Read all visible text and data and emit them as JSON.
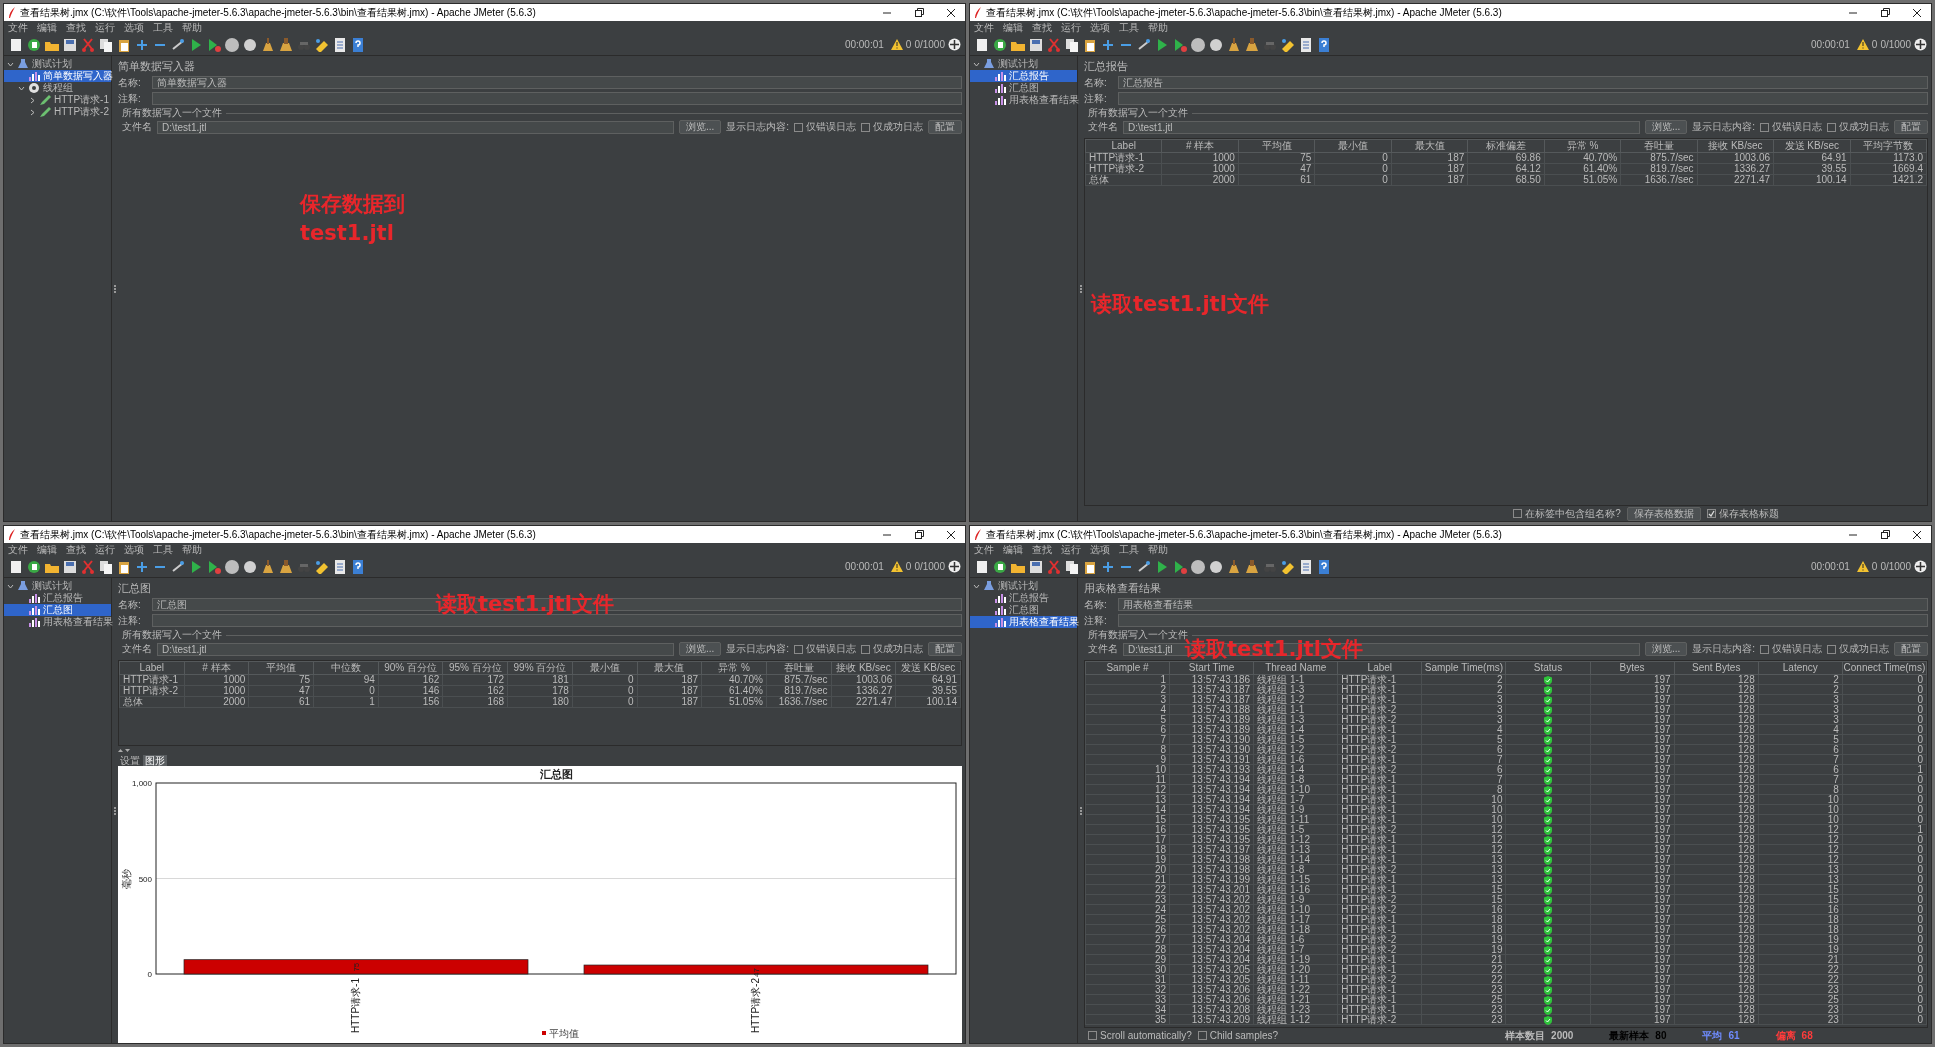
{
  "windows": [
    {
      "kind": "writer",
      "title": "查看结果树.jmx (C:\\软件\\Tools\\apache-jmeter-5.6.3\\apache-jmeter-5.6.3\\bin\\查看结果树.jmx) - Apache JMeter (5.6.3)",
      "menu": [
        "文件",
        "编辑",
        "查找",
        "运行",
        "选项",
        "工具",
        "帮助"
      ],
      "status": {
        "time": "00:00:01",
        "warnings": "0",
        "threads": "0/1000"
      },
      "tree": [
        {
          "label": "测试计划",
          "kind": "plan",
          "expanded": true,
          "selected": false,
          "children": [
            {
              "label": "简单数据写入器",
              "kind": "listener",
              "selected": true
            },
            {
              "label": "线程组",
              "kind": "group",
              "expanded": true,
              "selected": false,
              "children": [
                {
                  "label": "HTTP请求-1",
                  "kind": "sampler",
                  "expanded": false,
                  "selected": false
                },
                {
                  "label": "HTTP请求-2",
                  "kind": "sampler",
                  "expanded": false,
                  "selected": false
                }
              ]
            }
          ]
        }
      ],
      "panel": {
        "heading": "简单数据写入器",
        "name_label": "名称:",
        "name": "简单数据写入器",
        "comment_label": "注释:",
        "file_section": "所有数据写入一个文件",
        "file_label": "文件名",
        "file": "D:\\test1.jtl",
        "browse": "浏览...",
        "log_label": "显示日志内容:",
        "checks": [
          {
            "label": "仅错误日志",
            "checked": false
          },
          {
            "label": "仅成功日志",
            "checked": false
          }
        ],
        "config": "配置"
      },
      "annotation": [
        "保存数据到",
        "test1.jtl"
      ]
    },
    {
      "kind": "summary",
      "title": "查看结果树.jmx (C:\\软件\\Tools\\apache-jmeter-5.6.3\\apache-jmeter-5.6.3\\bin\\查看结果树.jmx) - Apache JMeter (5.6.3)",
      "menu": [
        "文件",
        "编辑",
        "查找",
        "运行",
        "选项",
        "工具",
        "帮助"
      ],
      "status": {
        "time": "00:00:01",
        "warnings": "0",
        "threads": "0/1000"
      },
      "tree": [
        {
          "label": "测试计划",
          "kind": "plan",
          "expanded": true,
          "selected": false,
          "children": [
            {
              "label": "汇总报告",
              "kind": "listener",
              "selected": true
            },
            {
              "label": "汇总图",
              "kind": "listener",
              "selected": false
            },
            {
              "label": "用表格查看结果",
              "kind": "listener",
              "selected": false
            }
          ]
        }
      ],
      "panel": {
        "heading": "汇总报告",
        "name_label": "名称:",
        "name": "汇总报告",
        "comment_label": "注释:",
        "file_section": "所有数据写入一个文件",
        "file_label": "文件名",
        "file": "D:\\test1.jtl",
        "browse": "浏览...",
        "log_label": "显示日志内容:",
        "checks": [
          {
            "label": "仅错误日志",
            "checked": false
          },
          {
            "label": "仅成功日志",
            "checked": false
          }
        ],
        "config": "配置"
      },
      "table": {
        "columns": [
          "Label",
          "# 样本",
          "平均值",
          "最小值",
          "最大值",
          "标准偏差",
          "异常 %",
          "吞吐量",
          "接收 KB/sec",
          "发送 KB/sec",
          "平均字节数"
        ],
        "rows": [
          [
            "HTTP请求-1",
            "1000",
            "75",
            "0",
            "187",
            "69.86",
            "40.70%",
            "875.7/sec",
            "1003.06",
            "64.91",
            "1173.0"
          ],
          [
            "HTTP请求-2",
            "1000",
            "47",
            "0",
            "187",
            "64.12",
            "61.40%",
            "819.7/sec",
            "1336.27",
            "39.55",
            "1669.4"
          ],
          [
            "总体",
            "2000",
            "61",
            "0",
            "187",
            "68.50",
            "51.05%",
            "1636.7/sec",
            "2271.47",
            "100.14",
            "1421.2"
          ]
        ]
      },
      "footer": [
        {
          "kind": "check",
          "label": "在标签中包含组名称?",
          "checked": false
        },
        {
          "kind": "button",
          "label": "保存表格数据"
        },
        {
          "kind": "check",
          "label": "保存表格标题",
          "checked": true
        }
      ],
      "annotation": [
        "读取test1.jtl文件"
      ]
    },
    {
      "kind": "graph",
      "title": "查看结果树.jmx (C:\\软件\\Tools\\apache-jmeter-5.6.3\\apache-jmeter-5.6.3\\bin\\查看结果树.jmx) - Apache JMeter (5.6.3)",
      "menu": [
        "文件",
        "编辑",
        "查找",
        "运行",
        "选项",
        "工具",
        "帮助"
      ],
      "status": {
        "time": "00:00:01",
        "warnings": "0",
        "threads": "0/1000"
      },
      "tree": [
        {
          "label": "测试计划",
          "kind": "plan",
          "expanded": true,
          "selected": false,
          "children": [
            {
              "label": "汇总报告",
              "kind": "listener",
              "selected": false
            },
            {
              "label": "汇总图",
              "kind": "listener",
              "selected": true
            },
            {
              "label": "用表格查看结果",
              "kind": "listener",
              "selected": false
            }
          ]
        }
      ],
      "panel": {
        "heading": "汇总图",
        "name_label": "名称:",
        "name": "汇总图",
        "comment_label": "注释:",
        "file_section": "所有数据写入一个文件",
        "file_label": "文件名",
        "file": "D:\\test1.jtl",
        "browse": "浏览...",
        "log_label": "显示日志内容:",
        "checks": [
          {
            "label": "仅错误日志",
            "checked": false
          },
          {
            "label": "仅成功日志",
            "checked": false
          }
        ],
        "config": "配置"
      },
      "table": {
        "columns": [
          "Label",
          "# 样本",
          "平均值",
          "中位数",
          "90% 百分位",
          "95% 百分位",
          "99% 百分位",
          "最小值",
          "最大值",
          "异常 %",
          "吞吐量",
          "接收 KB/sec",
          "发送 KB/sec"
        ],
        "rows": [
          [
            "HTTP请求-1",
            "1000",
            "75",
            "94",
            "162",
            "172",
            "181",
            "0",
            "187",
            "40.70%",
            "875.7/sec",
            "1003.06",
            "64.91"
          ],
          [
            "HTTP请求-2",
            "1000",
            "47",
            "0",
            "146",
            "162",
            "178",
            "0",
            "187",
            "61.40%",
            "819.7/sec",
            "1336.27",
            "39.55"
          ],
          [
            "总体",
            "2000",
            "61",
            "1",
            "156",
            "168",
            "180",
            "0",
            "187",
            "51.05%",
            "1636.7/sec",
            "2271.47",
            "100.14"
          ]
        ]
      },
      "tabs": [
        {
          "label": "设置",
          "selected": false
        },
        {
          "label": "图形",
          "selected": true
        }
      ],
      "chart_data": {
        "type": "bar",
        "title": "汇总图",
        "ylabel": "毫秒",
        "categories": [
          "HTTP请求-1",
          "HTTP请求-2"
        ],
        "series": [
          {
            "name": "平均值",
            "color": "#cc0000",
            "values": [
              75,
              47
            ]
          }
        ],
        "ylim": [
          0,
          1000
        ],
        "yticks": [
          0,
          500,
          {
            "value": 1000,
            "label": "1,000"
          }
        ],
        "data_labels": true
      },
      "annotation": [
        "读取test1.jtl文件"
      ]
    },
    {
      "kind": "view",
      "title": "查看结果树.jmx (C:\\软件\\Tools\\apache-jmeter-5.6.3\\apache-jmeter-5.6.3\\bin\\查看结果树.jmx) - Apache JMeter (5.6.3)",
      "menu": [
        "文件",
        "编辑",
        "查找",
        "运行",
        "选项",
        "工具",
        "帮助"
      ],
      "status": {
        "time": "00:00:01",
        "warnings": "0",
        "threads": "0/1000"
      },
      "tree": [
        {
          "label": "测试计划",
          "kind": "plan",
          "expanded": true,
          "selected": false,
          "children": [
            {
              "label": "汇总报告",
              "kind": "listener",
              "selected": false
            },
            {
              "label": "汇总图",
              "kind": "listener",
              "selected": false
            },
            {
              "label": "用表格查看结果",
              "kind": "listener",
              "selected": true
            }
          ]
        }
      ],
      "panel": {
        "heading": "用表格查看结果",
        "name_label": "名称:",
        "name": "用表格查看结果",
        "comment_label": "注释:",
        "file_section": "所有数据写入一个文件",
        "file_label": "文件名",
        "file": "D:\\test1.jtl",
        "browse": "浏览...",
        "log_label": "显示日志内容:",
        "checks": [
          {
            "label": "仅错误日志",
            "checked": false
          },
          {
            "label": "仅成功日志",
            "checked": false
          }
        ],
        "config": "配置"
      },
      "table": {
        "columns": [
          "Sample #",
          "Start Time",
          "Thread Name",
          "Label",
          "Sample Time(ms)",
          "Status",
          "Bytes",
          "Sent Bytes",
          "Latency",
          "Connect Time(ms)"
        ],
        "rows": [
          [
            "1",
            "13:57:43.186",
            "线程组 1-1",
            "HTTP请求-1",
            "2",
            true,
            "197",
            "128",
            "2",
            "0"
          ],
          [
            "2",
            "13:57:43.187",
            "线程组 1-3",
            "HTTP请求-1",
            "2",
            true,
            "197",
            "128",
            "2",
            "0"
          ],
          [
            "3",
            "13:57:43.187",
            "线程组 1-2",
            "HTTP请求-1",
            "3",
            true,
            "197",
            "128",
            "3",
            "0"
          ],
          [
            "4",
            "13:57:43.188",
            "线程组 1-1",
            "HTTP请求-2",
            "3",
            true,
            "197",
            "128",
            "3",
            "0"
          ],
          [
            "5",
            "13:57:43.189",
            "线程组 1-3",
            "HTTP请求-2",
            "3",
            true,
            "197",
            "128",
            "3",
            "0"
          ],
          [
            "6",
            "13:57:43.189",
            "线程组 1-4",
            "HTTP请求-1",
            "4",
            true,
            "197",
            "128",
            "4",
            "0"
          ],
          [
            "7",
            "13:57:43.190",
            "线程组 1-5",
            "HTTP请求-1",
            "5",
            true,
            "197",
            "128",
            "5",
            "0"
          ],
          [
            "8",
            "13:57:43.190",
            "线程组 1-2",
            "HTTP请求-2",
            "6",
            true,
            "197",
            "128",
            "6",
            "0"
          ],
          [
            "9",
            "13:57:43.191",
            "线程组 1-6",
            "HTTP请求-1",
            "7",
            true,
            "197",
            "128",
            "7",
            "0"
          ],
          [
            "10",
            "13:57:43.193",
            "线程组 1-4",
            "HTTP请求-2",
            "6",
            true,
            "197",
            "128",
            "6",
            "1"
          ],
          [
            "11",
            "13:57:43.194",
            "线程组 1-8",
            "HTTP请求-1",
            "7",
            true,
            "197",
            "128",
            "7",
            "0"
          ],
          [
            "12",
            "13:57:43.194",
            "线程组 1-10",
            "HTTP请求-1",
            "8",
            true,
            "197",
            "128",
            "8",
            "0"
          ],
          [
            "13",
            "13:57:43.194",
            "线程组 1-7",
            "HTTP请求-1",
            "10",
            true,
            "197",
            "128",
            "10",
            "0"
          ],
          [
            "14",
            "13:57:43.194",
            "线程组 1-9",
            "HTTP请求-1",
            "10",
            true,
            "197",
            "128",
            "10",
            "0"
          ],
          [
            "15",
            "13:57:43.195",
            "线程组 1-11",
            "HTTP请求-1",
            "10",
            true,
            "197",
            "128",
            "10",
            "0"
          ],
          [
            "16",
            "13:57:43.195",
            "线程组 1-5",
            "HTTP请求-2",
            "12",
            true,
            "197",
            "128",
            "12",
            "1"
          ],
          [
            "17",
            "13:57:43.195",
            "线程组 1-12",
            "HTTP请求-1",
            "12",
            true,
            "197",
            "128",
            "12",
            "0"
          ],
          [
            "18",
            "13:57:43.197",
            "线程组 1-13",
            "HTTP请求-1",
            "12",
            true,
            "197",
            "128",
            "12",
            "0"
          ],
          [
            "19",
            "13:57:43.198",
            "线程组 1-14",
            "HTTP请求-1",
            "13",
            true,
            "197",
            "128",
            "12",
            "0"
          ],
          [
            "20",
            "13:57:43.198",
            "线程组 1-8",
            "HTTP请求-2",
            "13",
            true,
            "197",
            "128",
            "13",
            "0"
          ],
          [
            "21",
            "13:57:43.199",
            "线程组 1-15",
            "HTTP请求-1",
            "13",
            true,
            "197",
            "128",
            "13",
            "0"
          ],
          [
            "22",
            "13:57:43.201",
            "线程组 1-16",
            "HTTP请求-1",
            "15",
            true,
            "197",
            "128",
            "15",
            "0"
          ],
          [
            "23",
            "13:57:43.202",
            "线程组 1-9",
            "HTTP请求-2",
            "15",
            true,
            "197",
            "128",
            "15",
            "0"
          ],
          [
            "24",
            "13:57:43.202",
            "线程组 1-10",
            "HTTP请求-2",
            "16",
            true,
            "197",
            "128",
            "16",
            "0"
          ],
          [
            "25",
            "13:57:43.202",
            "线程组 1-17",
            "HTTP请求-1",
            "18",
            true,
            "197",
            "128",
            "18",
            "0"
          ],
          [
            "26",
            "13:57:43.202",
            "线程组 1-18",
            "HTTP请求-1",
            "18",
            true,
            "197",
            "128",
            "18",
            "0"
          ],
          [
            "27",
            "13:57:43.204",
            "线程组 1-6",
            "HTTP请求-2",
            "19",
            true,
            "197",
            "128",
            "19",
            "0"
          ],
          [
            "28",
            "13:57:43.204",
            "线程组 1-7",
            "HTTP请求-2",
            "19",
            true,
            "197",
            "128",
            "19",
            "0"
          ],
          [
            "29",
            "13:57:43.204",
            "线程组 1-19",
            "HTTP请求-1",
            "21",
            true,
            "197",
            "128",
            "21",
            "0"
          ],
          [
            "30",
            "13:57:43.205",
            "线程组 1-20",
            "HTTP请求-1",
            "22",
            true,
            "197",
            "128",
            "22",
            "0"
          ],
          [
            "31",
            "13:57:43.205",
            "线程组 1-11",
            "HTTP请求-2",
            "22",
            true,
            "197",
            "128",
            "22",
            "0"
          ],
          [
            "32",
            "13:57:43.206",
            "线程组 1-22",
            "HTTP请求-1",
            "23",
            true,
            "197",
            "128",
            "23",
            "0"
          ],
          [
            "33",
            "13:57:43.206",
            "线程组 1-21",
            "HTTP请求-1",
            "25",
            true,
            "197",
            "128",
            "25",
            "0"
          ],
          [
            "34",
            "13:57:43.208",
            "线程组 1-23",
            "HTTP请求-1",
            "23",
            true,
            "197",
            "128",
            "23",
            "0"
          ],
          [
            "35",
            "13:57:43.209",
            "线程组 1-12",
            "HTTP请求-2",
            "23",
            true,
            "197",
            "128",
            "23",
            "0"
          ]
        ]
      },
      "footer": [
        {
          "kind": "check",
          "label": "Scroll automatically?",
          "checked": false
        },
        {
          "kind": "check",
          "label": "Child samples?",
          "checked": false
        }
      ],
      "stats": [
        {
          "label": "样本数目",
          "value": "2000",
          "color": "#bbbbbb"
        },
        {
          "label": "最新样本",
          "value": "80",
          "color": "#000000"
        },
        {
          "label": "平均",
          "value": "61",
          "color": "#6f8cff"
        },
        {
          "label": "偏离",
          "value": "68",
          "color": "#ff3b3b"
        }
      ],
      "annotation": [
        "读取test1.jtl文件"
      ]
    }
  ]
}
